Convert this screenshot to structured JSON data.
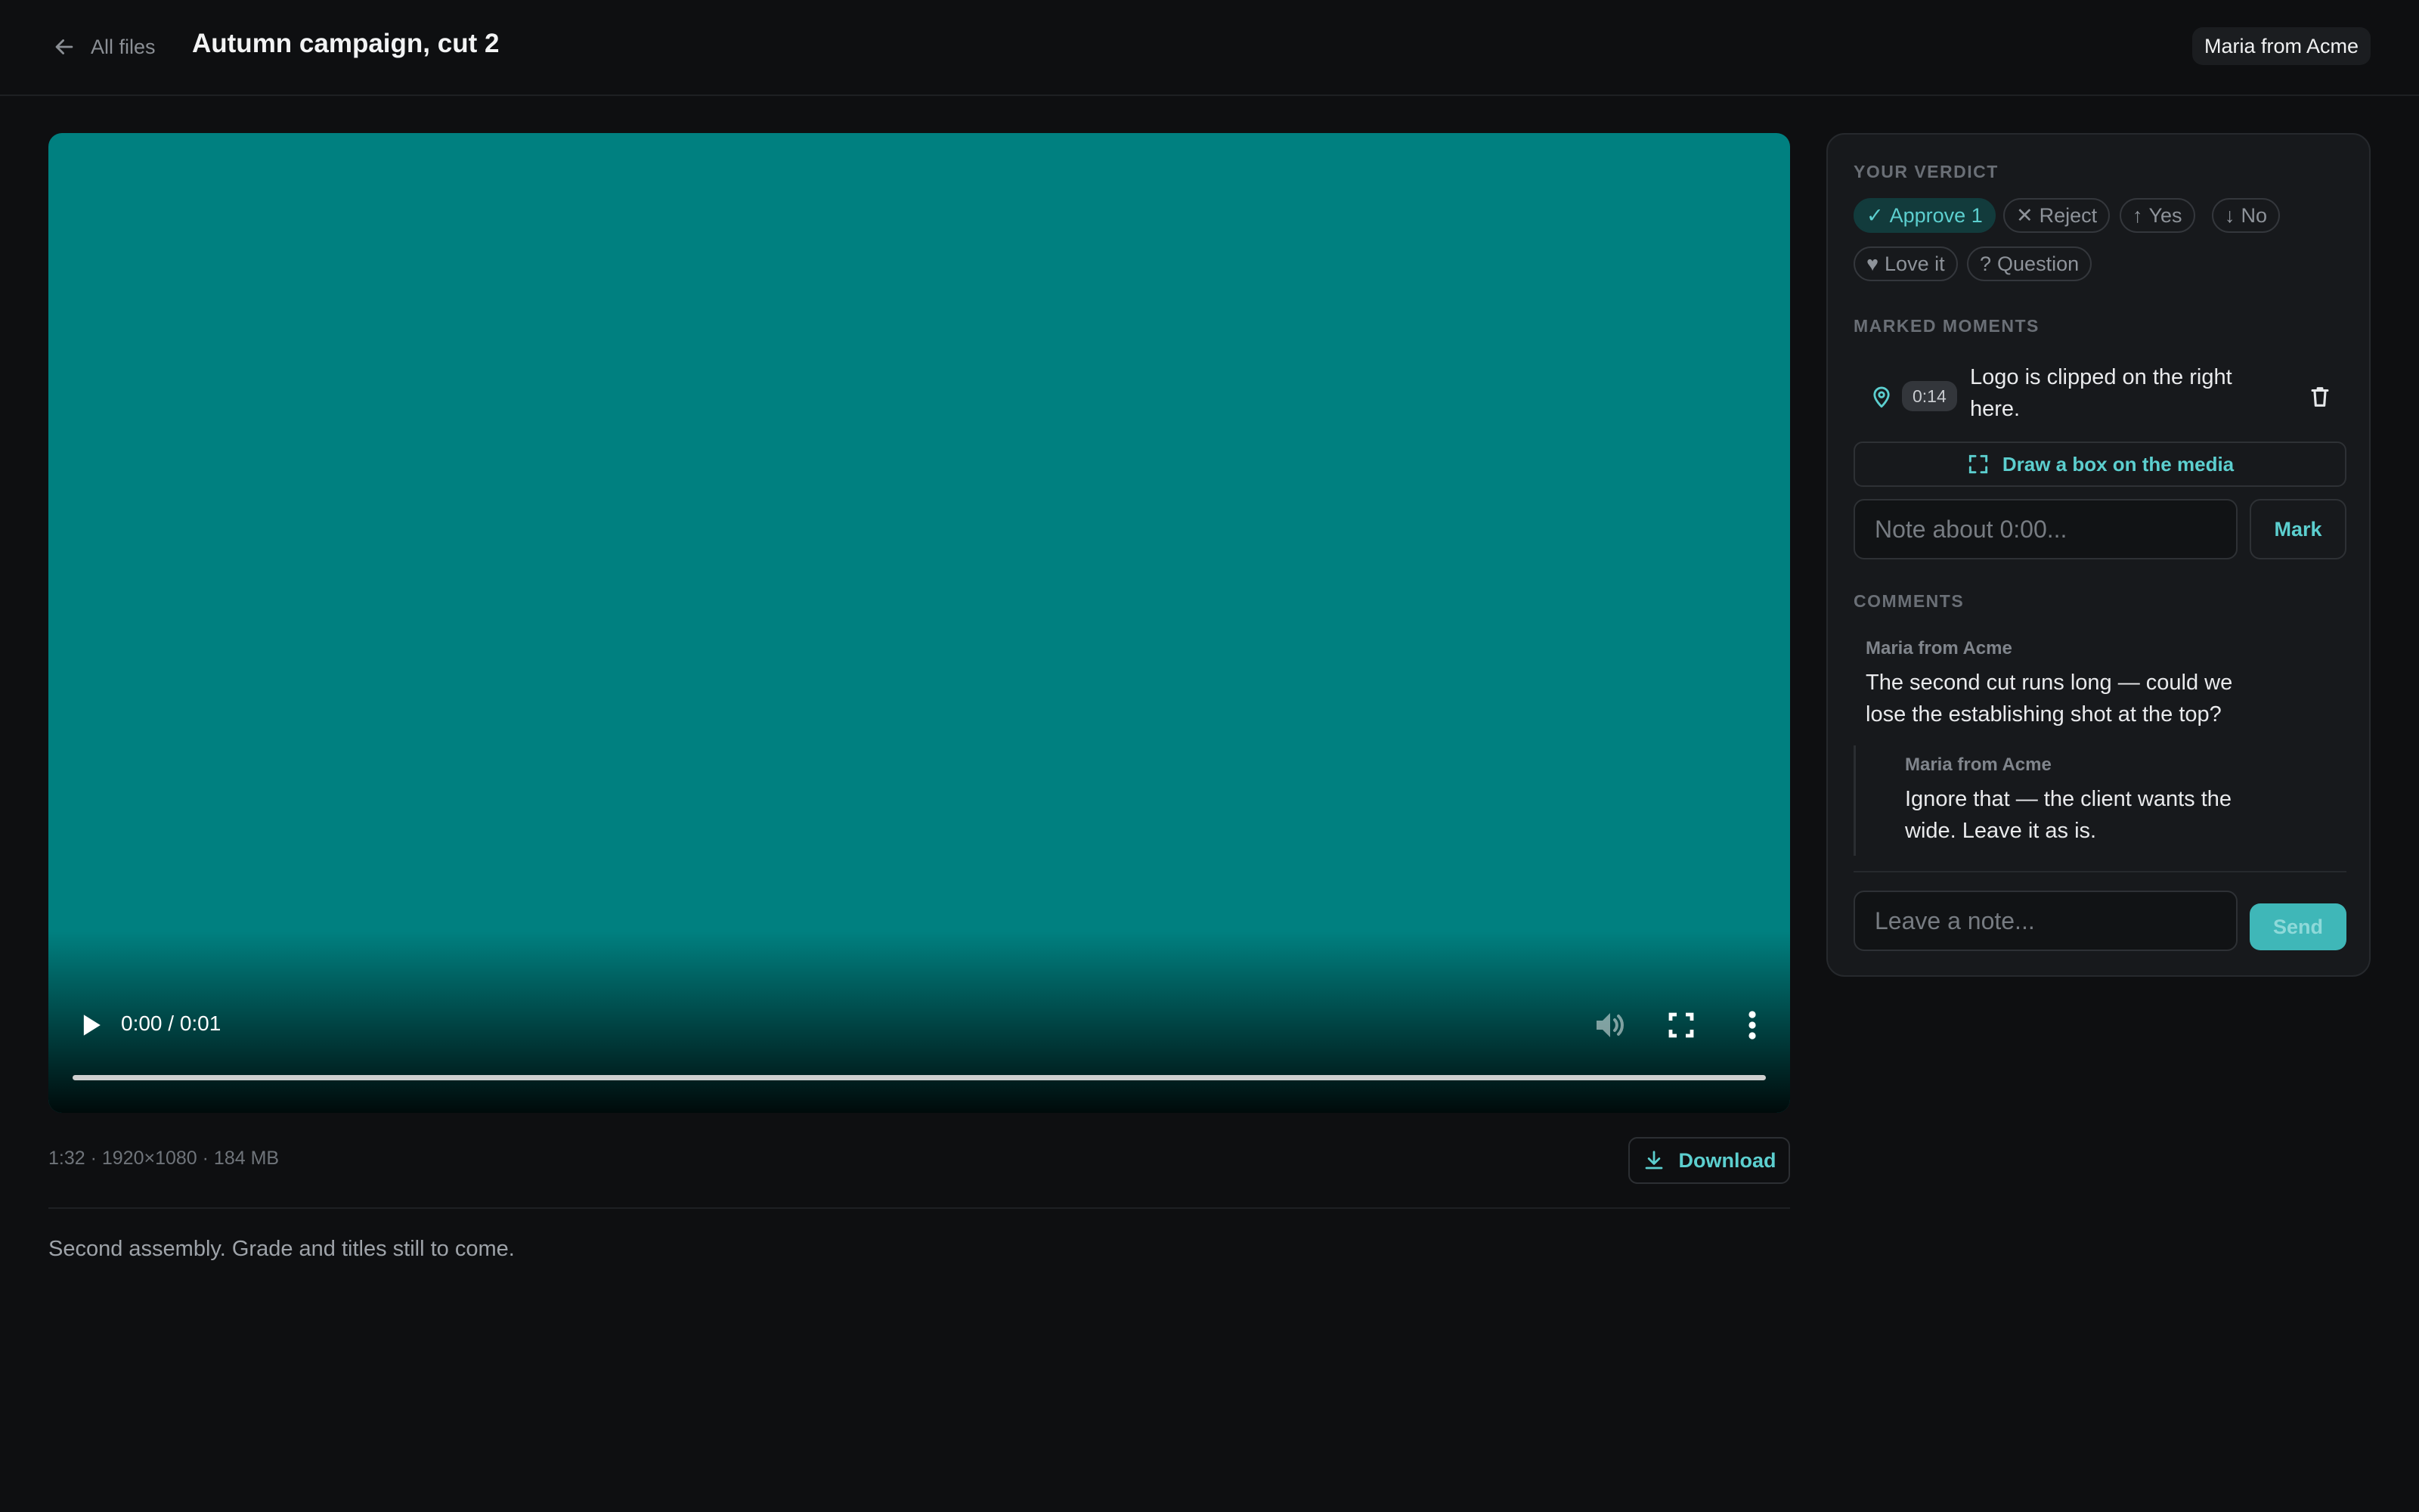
{
  "header": {
    "back_label": "All files",
    "back_icon": "arrow-left-icon",
    "title": "Autumn campaign, cut 2",
    "user": "Maria from Acme"
  },
  "video": {
    "background_color": "#008080",
    "time_display": "0:00 / 0:01",
    "progress": 0,
    "icons": [
      "play-icon",
      "volume-icon",
      "fullscreen-icon",
      "more-vertical-icon"
    ]
  },
  "file": {
    "meta": "1:32 · 1920×1080 · 184 MB",
    "download_label": "Download",
    "description": "Second assembly. Grade and titles still to come."
  },
  "verdict": {
    "label": "YOUR VERDICT",
    "options": [
      {
        "glyph": "✓",
        "text": "Approve 1",
        "active": true
      },
      {
        "glyph": "✕",
        "text": "Reject",
        "active": false
      },
      {
        "glyph": "↑",
        "text": "Yes",
        "active": false
      },
      {
        "glyph": "↓",
        "text": "No",
        "active": false
      },
      {
        "glyph": "♥",
        "text": "Love it",
        "active": false
      },
      {
        "glyph": "?",
        "text": "Question",
        "active": false
      }
    ]
  },
  "moments": {
    "label": "MARKED MOMENTS",
    "items": [
      {
        "time": "0:14",
        "text": "Logo is clipped on the right here."
      }
    ],
    "draw_box_label": "Draw a box on the media",
    "note_placeholder": "Note about 0:00...",
    "mark_label": "Mark"
  },
  "comments": {
    "label": "COMMENTS",
    "items": [
      {
        "author": "Maria from Acme",
        "body": "The second cut runs long — could we lose the establishing shot at the top?"
      },
      {
        "author": "Maria from Acme",
        "body": "Ignore that — the client wants the wide. Leave it as is.",
        "is_reply": true
      }
    ],
    "input_placeholder": "Leave a note...",
    "send_label": "Send"
  },
  "colors": {
    "accent": "#5ccfcf",
    "background": "#0e0f11",
    "panel": "#17191c"
  }
}
